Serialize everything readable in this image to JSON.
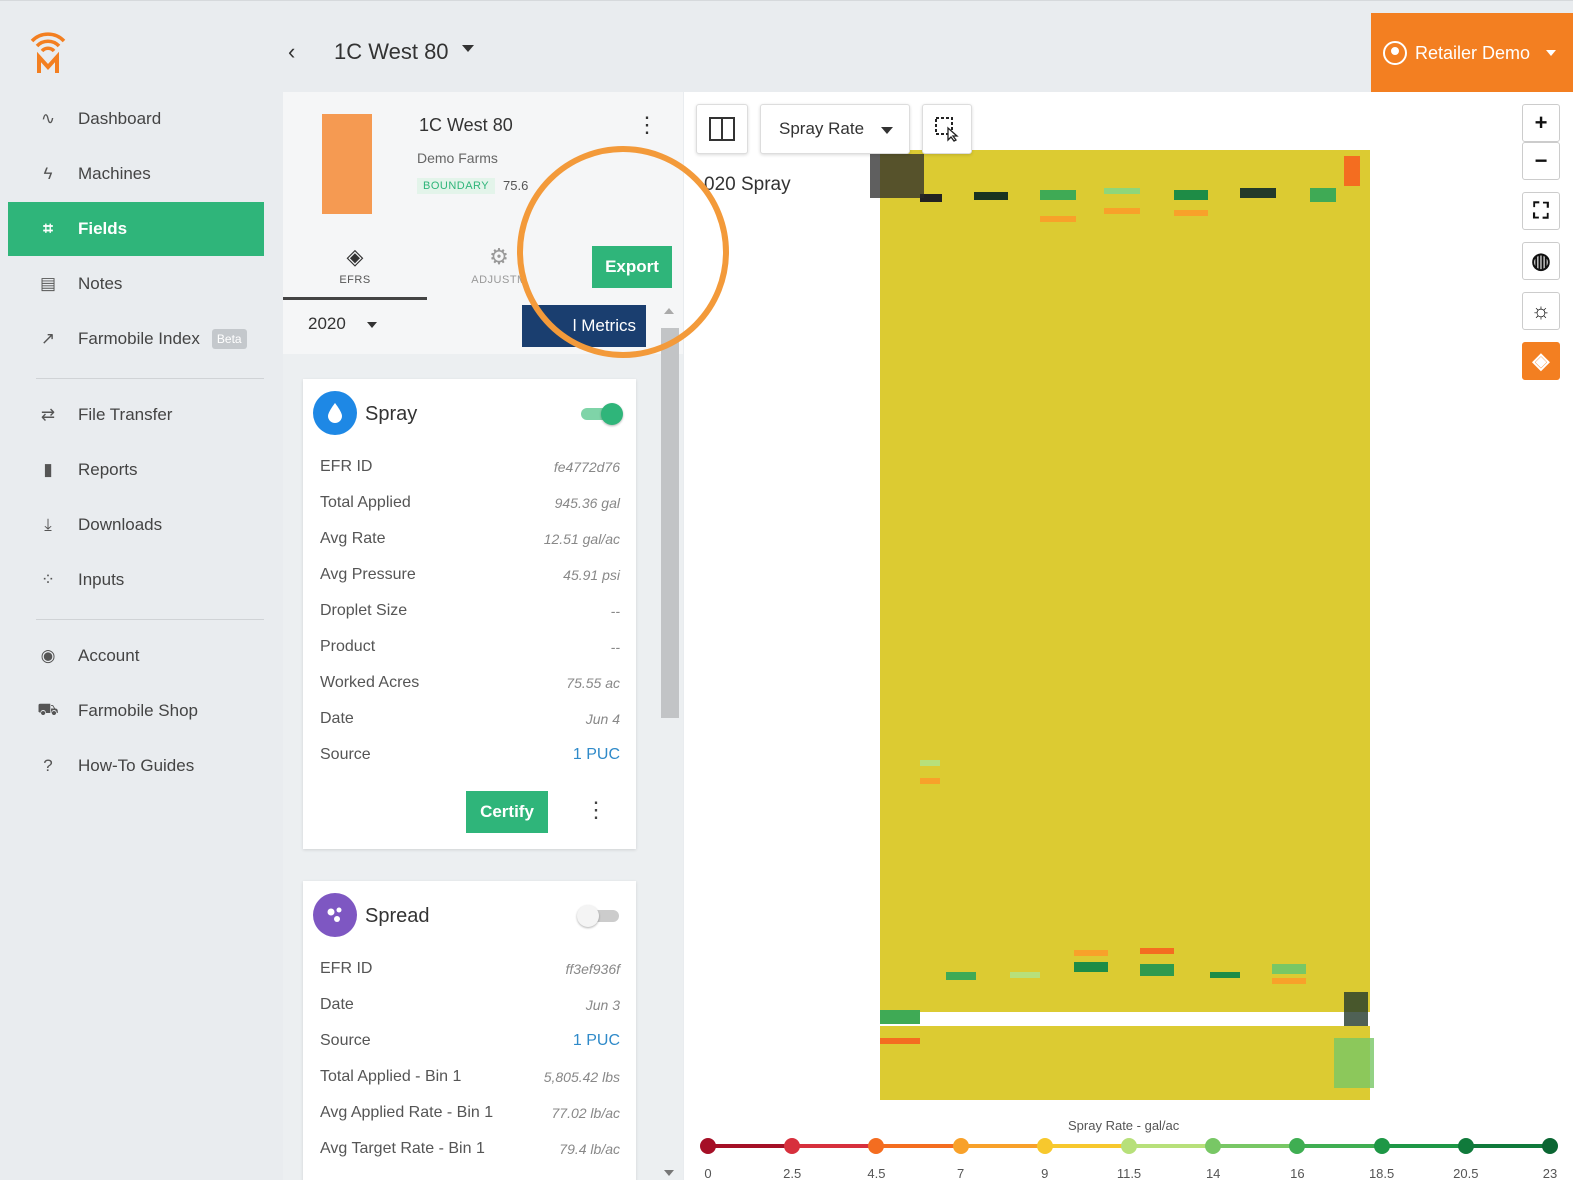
{
  "header": {
    "back_glyph": "‹",
    "field_title": "1C West 80",
    "user_label": "Retailer Demo",
    "accent_color": "#f37f21"
  },
  "sidebar": {
    "items": [
      {
        "label": "Dashboard",
        "icon": "pulse-icon"
      },
      {
        "label": "Machines",
        "icon": "bolt-icon"
      },
      {
        "label": "Fields",
        "icon": "field-icon",
        "active": true
      },
      {
        "label": "Notes",
        "icon": "clipboard-icon"
      },
      {
        "label": "Farmobile Index",
        "icon": "trend-icon",
        "badge": "Beta"
      },
      {
        "label": "File Transfer",
        "icon": "transfer-icon"
      },
      {
        "label": "Reports",
        "icon": "bar-chart-icon"
      },
      {
        "label": "Downloads",
        "icon": "download-icon"
      },
      {
        "label": "Inputs",
        "icon": "inputs-icon"
      },
      {
        "label": "Account",
        "icon": "account-icon"
      },
      {
        "label": "Farmobile Shop",
        "icon": "cart-icon"
      },
      {
        "label": "How-To Guides",
        "icon": "help-icon"
      }
    ]
  },
  "panel": {
    "field_name": "1C West 80",
    "farm": "Demo Farms",
    "badge": "BOUNDARY",
    "acres": "75.6",
    "tabs": [
      {
        "label": "EFRS",
        "icon": "layers-icon"
      },
      {
        "label": "ADJUSTM",
        "icon": "gear-icon"
      }
    ],
    "export_label": "Export",
    "year": "2020",
    "metrics_label": "l Metrics",
    "cards": [
      {
        "title": "Spray",
        "icon": "droplet-icon",
        "color": "#1e88e5",
        "toggle_on": true,
        "rows": [
          {
            "label": "EFR ID",
            "value": "fe4772d76"
          },
          {
            "label": "Total Applied",
            "value": "945.36 gal"
          },
          {
            "label": "Avg Rate",
            "value": "12.51 gal/ac"
          },
          {
            "label": "Avg Pressure",
            "value": "45.91 psi"
          },
          {
            "label": "Droplet Size",
            "value": "--"
          },
          {
            "label": "Product",
            "value": "--"
          },
          {
            "label": "Worked Acres",
            "value": "75.55 ac"
          },
          {
            "label": "Date",
            "value": "Jun 4"
          },
          {
            "label": "Source",
            "value": "1 PUC",
            "link": true
          }
        ],
        "certify_label": "Certify"
      },
      {
        "title": "Spread",
        "icon": "spread-icon",
        "color": "#7e57c2",
        "toggle_on": false,
        "rows": [
          {
            "label": "EFR ID",
            "value": "ff3ef936f"
          },
          {
            "label": "Date",
            "value": "Jun 3"
          },
          {
            "label": "Source",
            "value": "1 PUC",
            "link": true
          },
          {
            "label": "Total Applied - Bin 1",
            "value": "5,805.42 lbs"
          },
          {
            "label": "Avg Applied Rate - Bin 1",
            "value": "77.02 lb/ac"
          },
          {
            "label": "Avg Target Rate - Bin 1",
            "value": "79.4 lb/ac"
          }
        ]
      }
    ]
  },
  "map": {
    "layer_select": "Spray Rate",
    "title": "020 Spray",
    "field_color": "#dccb32",
    "legend": {
      "title": "Spray Rate - gal/ac",
      "ticks": [
        "0",
        "2.5",
        "4.5",
        "7",
        "9",
        "11.5",
        "14",
        "16",
        "18.5",
        "20.5",
        "23"
      ],
      "colors": [
        "#a50f26",
        "#d7303d",
        "#f46d20",
        "#f8a12a",
        "#f7c82d",
        "#b7e07a",
        "#78c765",
        "#3fae52",
        "#1e9746",
        "#107a3b",
        "#0b6633"
      ]
    },
    "controls": [
      {
        "glyph": "+",
        "icon": "zoom-in-icon"
      },
      {
        "glyph": "−",
        "icon": "zoom-out-icon"
      },
      {
        "glyph": "⛶",
        "icon": "fullscreen-icon"
      },
      {
        "glyph": "◍",
        "icon": "globe-icon"
      },
      {
        "glyph": "☼",
        "icon": "weather-icon"
      },
      {
        "glyph": "◈",
        "icon": "layers-icon"
      }
    ]
  }
}
